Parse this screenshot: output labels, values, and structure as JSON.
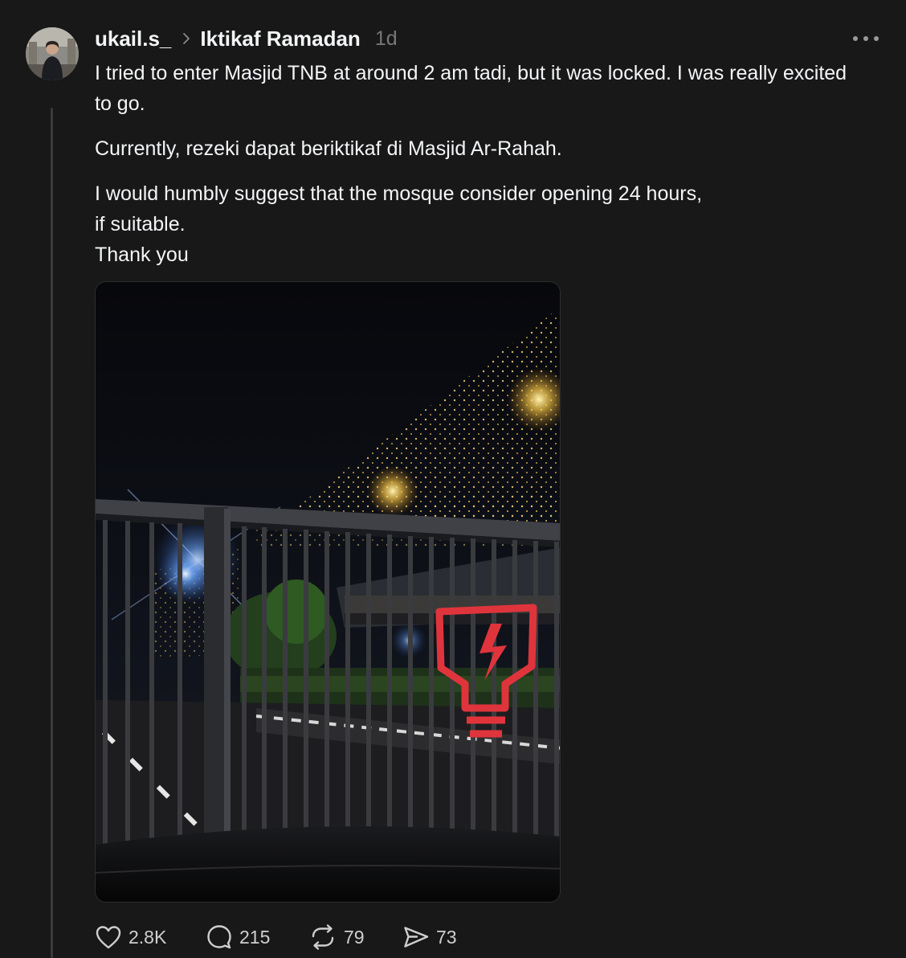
{
  "post": {
    "username": "ukail.s_",
    "community": "Iktikaf Ramadan",
    "time": "1d",
    "paragraphs": [
      [
        "I tried to enter Masjid TNB at around 2 am tadi, but it was locked. I was really excited to go."
      ],
      [
        "Currently, rezeki dapat beriktikaf di Masjid Ar-Rahah."
      ],
      [
        "I would humbly suggest that the mosque consider opening 24 hours,",
        "if suitable.",
        "Thank you"
      ]
    ],
    "photo": {
      "sign_color": "#e0343c",
      "light_color": "#f5c445"
    }
  },
  "actions": {
    "likes": "2.8K",
    "replies": "215",
    "reposts": "79",
    "shares": "73"
  },
  "icons": {
    "separator": "chevron-right-icon",
    "more": "more-horizontal-icon",
    "like": "heart-icon",
    "reply": "speech-bubble-icon",
    "repost": "repost-arrows-icon",
    "share": "send-icon"
  },
  "colors": {
    "background": "#181818",
    "text": "#f3f5f7",
    "muted": "#777777",
    "thread_line": "#3a3a3a"
  }
}
